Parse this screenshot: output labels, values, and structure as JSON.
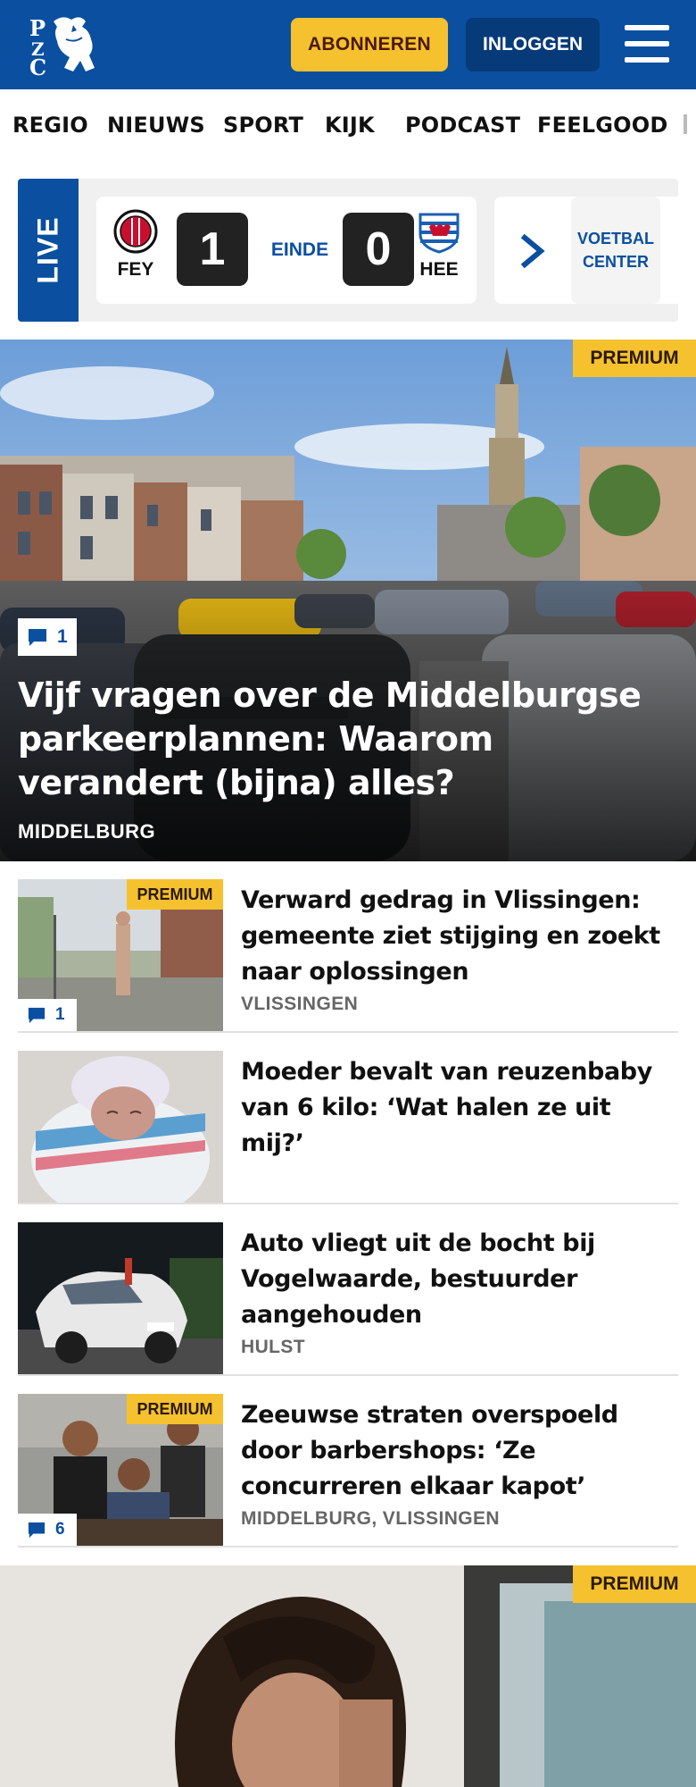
{
  "brand": {
    "logo_letters": [
      "P",
      "Z",
      "C"
    ],
    "primary_color": "#0a4fa0",
    "accent_color": "#f5c12e"
  },
  "header": {
    "subscribe_label": "ABONNEREN",
    "login_label": "INLOGGEN",
    "menu_icon": "hamburger-icon"
  },
  "nav": {
    "items": [
      "REGIO",
      "NIEUWS",
      "SPORT",
      "KIJK",
      "PODCAST",
      "FEELGOOD"
    ]
  },
  "live": {
    "label": "LIVE",
    "home": {
      "abbr": "FEY",
      "score": "1"
    },
    "away": {
      "abbr": "HEE",
      "score": "0"
    },
    "status": "EINDE",
    "center_label": "VOETBAL CENTER"
  },
  "hero": {
    "badge": "PREMIUM",
    "comments": "1",
    "title": "Vijf vragen over de Middelburgse parkeerplannen: Waarom verandert (bijna) alles?",
    "location": "MIDDELBURG"
  },
  "articles": [
    {
      "title": "Verward gedrag in Vlissingen: gemeente ziet stijging en zoekt naar oplossingen",
      "location": "VLISSINGEN",
      "badge": "PREMIUM",
      "comments": "1"
    },
    {
      "title": "Moeder bevalt van reuzenbaby van 6 kilo: ‘Wat halen ze uit mij?’",
      "location": "",
      "badge": "",
      "comments": ""
    },
    {
      "title": "Auto vliegt uit de bocht bij Vogelwaarde, bestuurder aangehouden",
      "location": "HULST",
      "badge": "",
      "comments": ""
    },
    {
      "title": "Zeeuwse straten overspoeld door barbershops: ‘Ze concurreren elkaar kapot’",
      "location": "MIDDELBURG, VLISSINGEN",
      "badge": "PREMIUM",
      "comments": "6"
    }
  ],
  "bottom": {
    "badge": "PREMIUM"
  }
}
